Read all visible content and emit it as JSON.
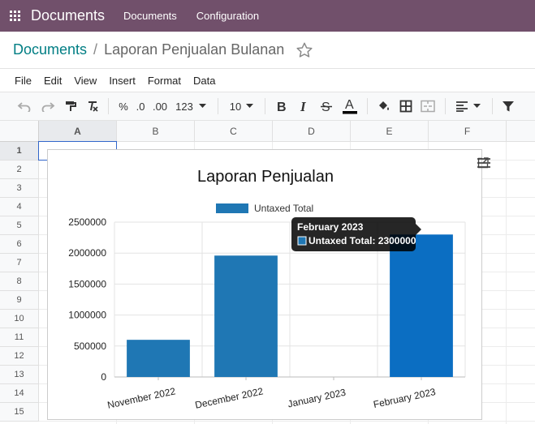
{
  "navbar": {
    "app_title": "Documents",
    "menu": [
      "Documents",
      "Configuration"
    ],
    "bg_color": "#71506b"
  },
  "breadcrumb": {
    "parent": "Documents",
    "separator": "/",
    "current": "Laporan Penjualan Bulanan"
  },
  "menubar": [
    "File",
    "Edit",
    "View",
    "Insert",
    "Format",
    "Data"
  ],
  "toolbar": {
    "percent": "%",
    "decrease_decimal": ".0",
    "increase_decimal": ".00",
    "more_formats": "123",
    "font_size": "10"
  },
  "grid": {
    "columns": [
      "A",
      "B",
      "C",
      "D",
      "E",
      "F"
    ],
    "rows": [
      "1",
      "2",
      "3",
      "4",
      "5",
      "6",
      "7",
      "8",
      "9",
      "10",
      "11",
      "12",
      "13",
      "14",
      "15"
    ],
    "selected_cell": "A1"
  },
  "chart_data": {
    "type": "bar",
    "title": "Laporan Penjualan",
    "categories": [
      "November 2022",
      "December 2022",
      "January 2023",
      "February 2023"
    ],
    "series": [
      {
        "name": "Untaxed Total",
        "values": [
          600000,
          1960000,
          0,
          2300000
        ],
        "color": "#1f77b4"
      }
    ],
    "ylim": [
      0,
      2500000
    ],
    "yticks": [
      "0",
      "500000",
      "1000000",
      "1500000",
      "2000000",
      "2500000"
    ],
    "grid": true,
    "legend_position": "top",
    "highlight_color": "#0b6ec2",
    "tooltip": {
      "title": "February 2023",
      "text": "Untaxed Total: 2300000"
    }
  }
}
